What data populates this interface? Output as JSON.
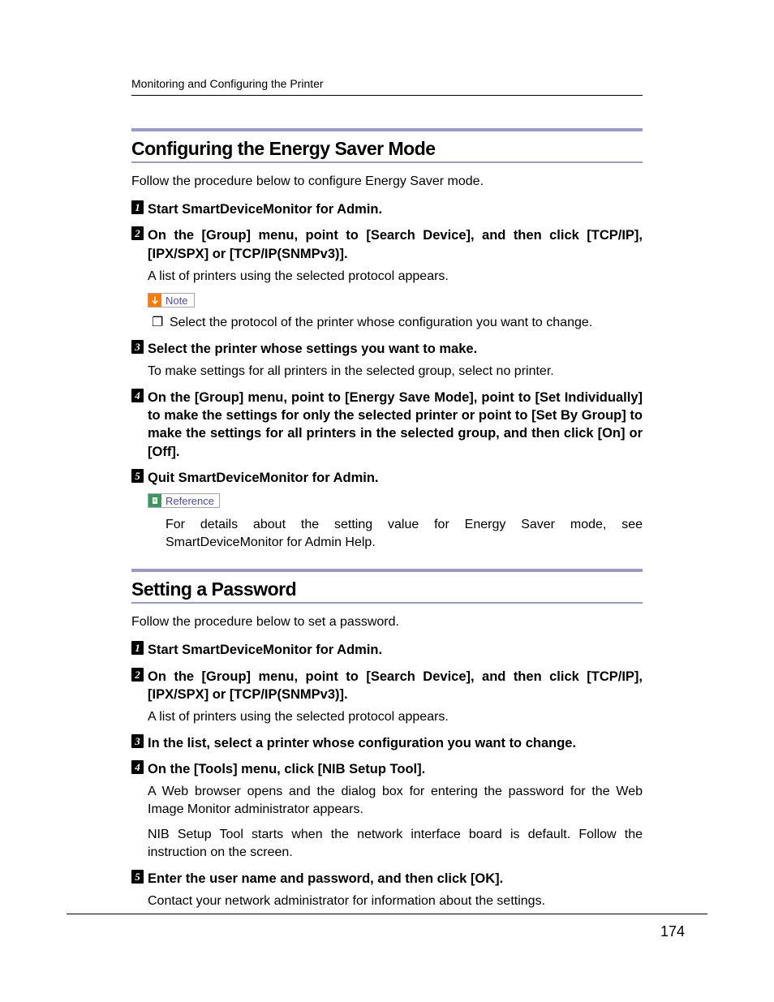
{
  "header": "Monitoring and Configuring the Printer",
  "pageNumber": "174",
  "badges": {
    "note": "Note",
    "reference": "Reference"
  },
  "bullet": "❐",
  "section1": {
    "heading": "Configuring the Energy Saver Mode",
    "intro": "Follow the procedure below to configure Energy Saver mode.",
    "step1": {
      "title": "Start SmartDeviceMonitor for Admin."
    },
    "step2": {
      "title": "On the [Group] menu, point to [Search Device], and then click [TCP/IP], [IPX/SPX] or [TCP/IP(SNMPv3)].",
      "body": "A list of printers using the selected protocol appears.",
      "noteText": "Select the protocol of the printer whose configuration you want to change."
    },
    "step3": {
      "title": "Select the printer whose settings you want to make.",
      "body": "To make settings for all printers in the selected group, select no printer."
    },
    "step4": {
      "title": "On the [Group] menu, point to [Energy Save Mode], point to [Set Individually] to make the settings for only the selected printer or point to [Set By Group] to make the settings for all printers in the selected group, and then click [On] or [Off]."
    },
    "step5": {
      "title": "Quit SmartDeviceMonitor for Admin.",
      "refText": "For details about the setting value for Energy Saver mode, see SmartDeviceMonitor for Admin Help."
    }
  },
  "section2": {
    "heading": "Setting a Password",
    "intro": "Follow the procedure below to set a password.",
    "step1": {
      "title": "Start SmartDeviceMonitor for Admin."
    },
    "step2": {
      "title": "On the [Group] menu, point to [Search Device], and then click [TCP/IP], [IPX/SPX] or [TCP/IP(SNMPv3)].",
      "body": "A list of printers using the selected protocol appears."
    },
    "step3": {
      "title": "In the list, select a printer whose configuration you want to change."
    },
    "step4": {
      "title": "On the [Tools] menu, click [NIB Setup Tool].",
      "body1": "A Web browser opens and the dialog box for entering the password for the Web Image Monitor administrator appears.",
      "body2": "NIB Setup Tool starts when the network interface board is default. Follow the instruction on the screen."
    },
    "step5": {
      "title": "Enter the user name and password, and then click [OK].",
      "body": "Contact your network administrator for information about the settings."
    }
  }
}
